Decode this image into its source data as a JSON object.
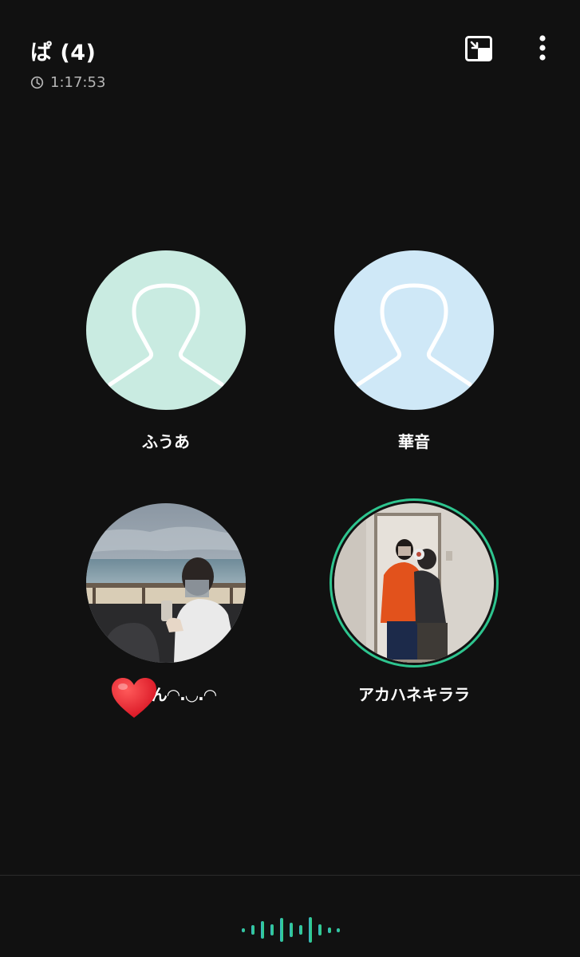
{
  "header": {
    "title": "ぱ (4)",
    "duration": "1:17:53"
  },
  "participants": [
    {
      "name": "ふうあ",
      "avatar": "default-silhouette",
      "color": "#c9ebe1"
    },
    {
      "name": "華音",
      "avatar": "default-silhouette",
      "color": "#cfe8f7"
    },
    {
      "name": "ぃ❤️ん◠.◡.◠",
      "avatar": "seaside-photo"
    },
    {
      "name": "アカハネキララ",
      "avatar": "couple-photo",
      "speaking": true
    }
  ],
  "colors": {
    "background": "#111111",
    "speaking_ring": "#2ec58f",
    "voice_wave_start": "#3ab3c9",
    "voice_wave_end": "#2fd37c"
  },
  "icons": {
    "duration": "clock-icon",
    "pip": "picture-in-picture-icon",
    "menu": "more-vertical-icon",
    "voice": "voice-wave-icon"
  }
}
